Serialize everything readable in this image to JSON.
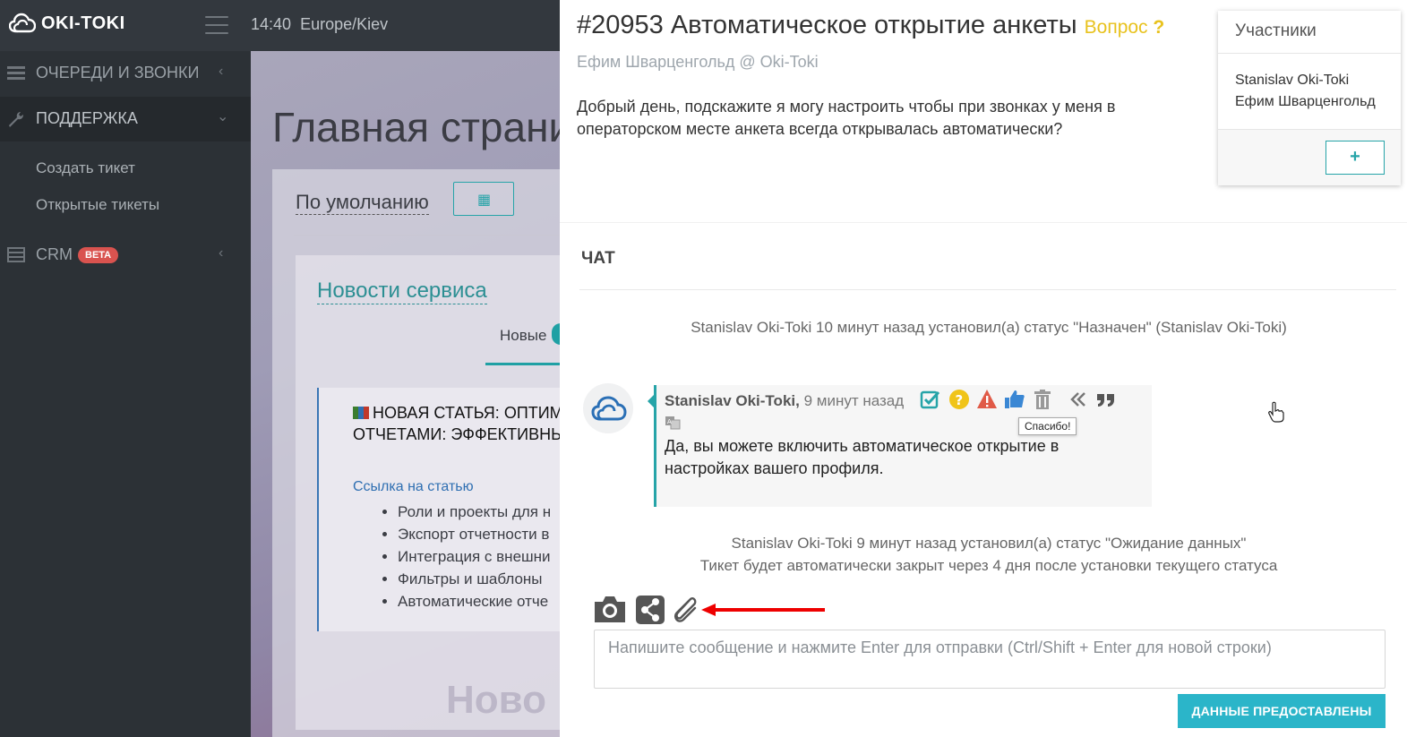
{
  "app": {
    "logo_text": "OKI-TOKI",
    "time": "14:40",
    "timezone": "Europe/Kiev"
  },
  "sidebar": {
    "items": [
      {
        "label": "ОЧЕРЕДИ И ЗВОНКИ",
        "icon": "list-icon",
        "expanded": false
      },
      {
        "label": "ПОДДЕРЖКА",
        "icon": "wrench-icon",
        "expanded": true
      },
      {
        "label": "CRM",
        "icon": "table-icon",
        "badge": "BETA",
        "expanded": false
      }
    ],
    "subitems": [
      "Создать тикет",
      "Открытые тикеты"
    ]
  },
  "background_page": {
    "title": "Главная страни",
    "default_label": "По умолчанию",
    "news_title": "Новости сервиса",
    "tab_new": "Новые",
    "article_heading_1": "НОВАЯ СТАТЬЯ: ОПТИМ",
    "article_heading_2": "ОТЧЕТАМИ: ЭФФЕКТИВНЫ",
    "article_link": "Ссылка на статью",
    "article_bullets": [
      "Роли и проекты для н",
      "Экспорт отчетности в",
      "Интеграция с внешни",
      "Фильтры и шаблоны",
      "Автоматические отче"
    ],
    "watermark": "Ново"
  },
  "ticket": {
    "number": "#20953",
    "title": "Автоматическое открытие анкеты",
    "type": "Вопрос",
    "type_mark": "?",
    "author": "Ефим Шварценгольд @ Oki-Toki",
    "body": "Добрый день, подскажите я могу настроить чтобы при звонках у меня в операторском месте анкета всегда открывалась автоматически?"
  },
  "participants": {
    "header": "Участники",
    "names": [
      "Stanislav Oki-Toki",
      "Ефим Шварценгольд"
    ],
    "add_label": "+"
  },
  "chat": {
    "header": "ЧАТ",
    "system_1": "Stanislav Oki-Toki 10 минут назад установил(а) статус \"Назначен\" (Stanislav Oki-Toki)",
    "message": {
      "author": "Stanislav Oki-Toki,",
      "time": "9 минут назад",
      "text": "Да, вы можете включить автоматическое открытие в настройках вашего профиля.",
      "tooltip": "Спасибо!"
    },
    "system_2_line1": "Stanislav Oki-Toki 9 минут назад установил(а) статус \"Ожидание данных\"",
    "system_2_line2": "Тикет будет автоматически закрыт через 4 дня после установки текущего статуса"
  },
  "composer": {
    "placeholder": "Напишите сообщение и нажмите Enter для отправки (Ctrl/Shift + Enter для новой строки)",
    "submit_label": "ДАННЫЕ ПРЕДОСТАВЛЕНЫ"
  },
  "colors": {
    "accent": "#26a4a8",
    "question": "#e8c21e",
    "topbar": "#33383e",
    "sidebar": "#2c3136",
    "submit": "#2bb5c9"
  }
}
